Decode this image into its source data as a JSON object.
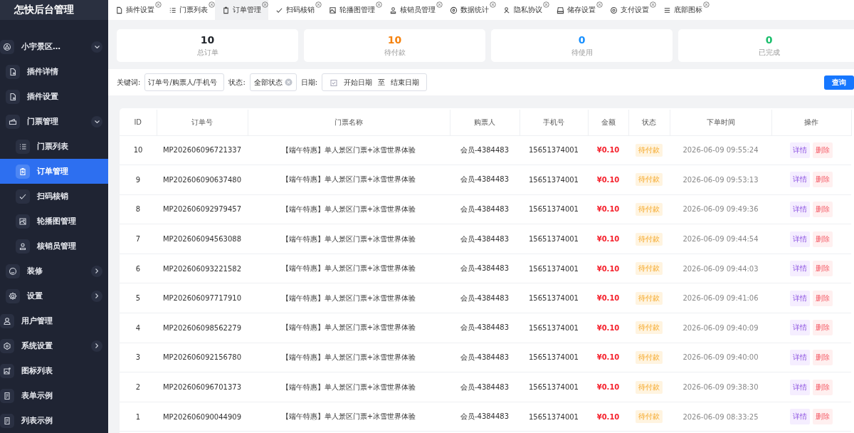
{
  "sidebar": {
    "title": "怎快后台管理",
    "items": [
      {
        "label": "小宇景区…",
        "kind": "group",
        "expanded": true,
        "selected": false,
        "children": [
          {
            "label": "插件详情",
            "kind": "link",
            "selected": false
          },
          {
            "label": "插件设置",
            "kind": "link",
            "selected": false
          },
          {
            "label": "门票管理",
            "kind": "group",
            "expanded": true,
            "selected": false,
            "children": [
              {
                "label": "门票列表",
                "kind": "link",
                "selected": false
              },
              {
                "label": "订单管理",
                "kind": "link",
                "selected": true
              },
              {
                "label": "扫码核销",
                "kind": "link",
                "selected": false
              },
              {
                "label": "轮播图管理",
                "kind": "link",
                "selected": false
              },
              {
                "label": "核销员管理",
                "kind": "link",
                "selected": false
              }
            ]
          },
          {
            "label": "装修",
            "kind": "group",
            "expanded": false,
            "selected": false
          },
          {
            "label": "设置",
            "kind": "group",
            "expanded": false,
            "selected": false
          }
        ]
      },
      {
        "label": "用户管理",
        "kind": "link",
        "selected": false
      },
      {
        "label": "系统设置",
        "kind": "group",
        "expanded": false,
        "selected": false
      },
      {
        "label": "图标列表",
        "kind": "link",
        "selected": false
      },
      {
        "label": "表单示例",
        "kind": "link",
        "selected": false
      },
      {
        "label": "列表示例",
        "kind": "link",
        "selected": false
      }
    ]
  },
  "tabs": [
    {
      "label": "插件设置",
      "selected": false
    },
    {
      "label": "门票列表",
      "selected": false
    },
    {
      "label": "订单管理",
      "selected": true
    },
    {
      "label": "扫码核销",
      "selected": false
    },
    {
      "label": "轮播图管理",
      "selected": false
    },
    {
      "label": "核销员管理",
      "selected": false
    },
    {
      "label": "数据统计",
      "selected": false
    },
    {
      "label": "隐私协议",
      "selected": false
    },
    {
      "label": "储存设置",
      "selected": false
    },
    {
      "label": "支付设置",
      "selected": false
    },
    {
      "label": "底部图标",
      "selected": false
    }
  ],
  "stats": [
    {
      "value": "10",
      "label": "总订单",
      "color": "#1f2329"
    },
    {
      "value": "10",
      "label": "待付款",
      "color": "#f5820f"
    },
    {
      "value": "0",
      "label": "待使用",
      "color": "#1890ff"
    },
    {
      "value": "0",
      "label": "已完成",
      "color": "#19be6b"
    }
  ],
  "filters": {
    "keyword_label": "关键词:",
    "keyword_placeholder": "订单号/购票人/手机号",
    "status_label": "状态:",
    "status_value": "全部状态",
    "date_label": "日期:",
    "date_start_placeholder": "开始日期",
    "date_separator": "至",
    "date_end_placeholder": "结束日期",
    "query_button": "查询"
  },
  "table": {
    "columns": [
      "ID",
      "订单号",
      "门票名称",
      "购票人",
      "手机号",
      "金额",
      "状态",
      "下单时间",
      "操作"
    ],
    "rows": [
      {
        "id": "10",
        "order_no": "MP202606096721337",
        "ticket": "【端午特惠】单人景区门票+冰雪世界体验",
        "buyer": "会员-4384483",
        "phone": "15651374001",
        "amount": "¥0.10",
        "status": "待付款",
        "time": "2026-06-09 09:55:24",
        "actions": [
          "详情",
          "删除"
        ]
      },
      {
        "id": "9",
        "order_no": "MP202606090637480",
        "ticket": "【端午特惠】单人景区门票+冰雪世界体验",
        "buyer": "会员-4384483",
        "phone": "15651374001",
        "amount": "¥0.10",
        "status": "待付款",
        "time": "2026-06-09 09:53:13",
        "actions": [
          "详情",
          "删除"
        ]
      },
      {
        "id": "8",
        "order_no": "MP202606092979457",
        "ticket": "【端午特惠】单人景区门票+冰雪世界体验",
        "buyer": "会员-4384483",
        "phone": "15651374001",
        "amount": "¥0.10",
        "status": "待付款",
        "time": "2026-06-09 09:49:36",
        "actions": [
          "详情",
          "删除"
        ]
      },
      {
        "id": "7",
        "order_no": "MP202606094563088",
        "ticket": "【端午特惠】单人景区门票+冰雪世界体验",
        "buyer": "会员-4384483",
        "phone": "15651374001",
        "amount": "¥0.10",
        "status": "待付款",
        "time": "2026-06-09 09:44:54",
        "actions": [
          "详情",
          "删除"
        ]
      },
      {
        "id": "6",
        "order_no": "MP202606093221582",
        "ticket": "【端午特惠】单人景区门票+冰雪世界体验",
        "buyer": "会员-4384483",
        "phone": "15651374001",
        "amount": "¥0.10",
        "status": "待付款",
        "time": "2026-06-09 09:44:03",
        "actions": [
          "详情",
          "删除"
        ]
      },
      {
        "id": "5",
        "order_no": "MP202606097717910",
        "ticket": "【端午特惠】单人景区门票+冰雪世界体验",
        "buyer": "会员-4384483",
        "phone": "15651374001",
        "amount": "¥0.10",
        "status": "待付款",
        "time": "2026-06-09 09:41:06",
        "actions": [
          "详情",
          "删除"
        ]
      },
      {
        "id": "4",
        "order_no": "MP202606098562279",
        "ticket": "【端午特惠】单人景区门票+冰雪世界体验",
        "buyer": "会员-4384483",
        "phone": "15651374001",
        "amount": "¥0.10",
        "status": "待付款",
        "time": "2026-06-09 09:40:09",
        "actions": [
          "详情",
          "删除"
        ]
      },
      {
        "id": "3",
        "order_no": "MP202606092156780",
        "ticket": "【端午特惠】单人景区门票+冰雪世界体验",
        "buyer": "会员-4384483",
        "phone": "15651374001",
        "amount": "¥0.10",
        "status": "待付款",
        "time": "2026-06-09 09:40:00",
        "actions": [
          "详情",
          "删除"
        ]
      },
      {
        "id": "2",
        "order_no": "MP202606096701373",
        "ticket": "【端午特惠】单人景区门票+冰雪世界体验",
        "buyer": "会员-4384483",
        "phone": "15651374001",
        "amount": "¥0.10",
        "status": "待付款",
        "time": "2026-06-09 09:38:30",
        "actions": [
          "详情",
          "删除"
        ]
      },
      {
        "id": "1",
        "order_no": "MP202606090044909",
        "ticket": "【端午特惠】单人景区门票+冰雪世界体验",
        "buyer": "会员-4384483",
        "phone": "15651374001",
        "amount": "¥0.10",
        "status": "待付款",
        "time": "2026-06-09 08:33:25",
        "actions": [
          "详情",
          "删除"
        ]
      }
    ]
  }
}
